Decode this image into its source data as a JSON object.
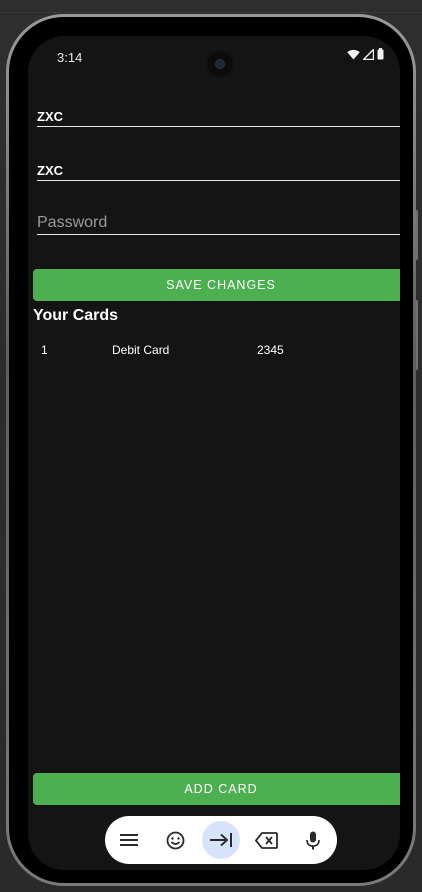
{
  "status_bar": {
    "time": "3:14",
    "icons": [
      "wifi-icon",
      "cellular-signal-icon",
      "battery-icon"
    ]
  },
  "form": {
    "field1_value": "ZXC",
    "field2_value": "ZXC",
    "password_placeholder": "Password",
    "save_label": "SAVE CHANGES"
  },
  "cards_section": {
    "title": "Your Cards",
    "cards": [
      {
        "id": "1",
        "type": "Debit Card",
        "number": "2345"
      }
    ]
  },
  "add_card_label": "ADD CARD",
  "keyboard_toolbar": {
    "icons": [
      "menu-icon",
      "emoji-icon",
      "tab-icon",
      "backspace-icon",
      "microphone-icon"
    ],
    "active": "tab-icon"
  },
  "colors": {
    "accent_green": "#4caf50",
    "screen_bg": "#141414",
    "toolbar_active": "#d6e3fb"
  }
}
